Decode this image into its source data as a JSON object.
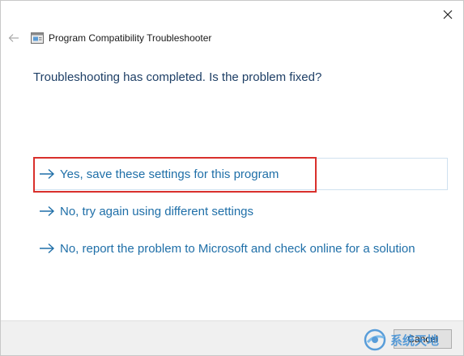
{
  "window": {
    "title": "Program Compatibility Troubleshooter"
  },
  "icons": {
    "close": "close-icon",
    "back": "back-arrow-icon",
    "app": "troubleshooter-app-icon",
    "option_arrow": "right-arrow-icon"
  },
  "main": {
    "question": "Troubleshooting has completed.  Is the problem fixed?",
    "options": [
      {
        "label": "Yes, save these settings for this program"
      },
      {
        "label": "No, try again using different settings"
      },
      {
        "label": "No, report the problem to Microsoft and check online for a solution"
      }
    ]
  },
  "footer": {
    "cancel_label": "Cancel"
  },
  "watermark": {
    "text": "系统天地"
  },
  "colors": {
    "link": "#1f6fa8",
    "heading": "#1e3f66",
    "highlight": "#d9302c",
    "footer_bg": "#f0f0f0"
  }
}
